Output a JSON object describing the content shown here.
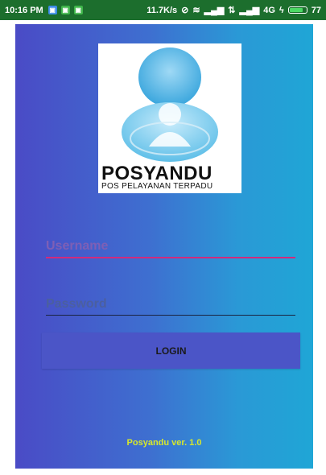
{
  "status_bar": {
    "time": "10:16 PM",
    "network_speed": "11.7K/s",
    "network_type": "4G",
    "battery_percent": "77"
  },
  "logo": {
    "brand_name": "POSYANDU",
    "brand_subtitle": "POS PELAYANAN TERPADU"
  },
  "form": {
    "username_placeholder": "Username",
    "password_placeholder": "Password",
    "login_label": "LOGIN"
  },
  "footer": {
    "version_text": "Posyandu ver. 1.0"
  },
  "colors": {
    "accent_underline": "#d22a7c",
    "button": "#4b55c7",
    "version_text": "#d8e82a"
  }
}
